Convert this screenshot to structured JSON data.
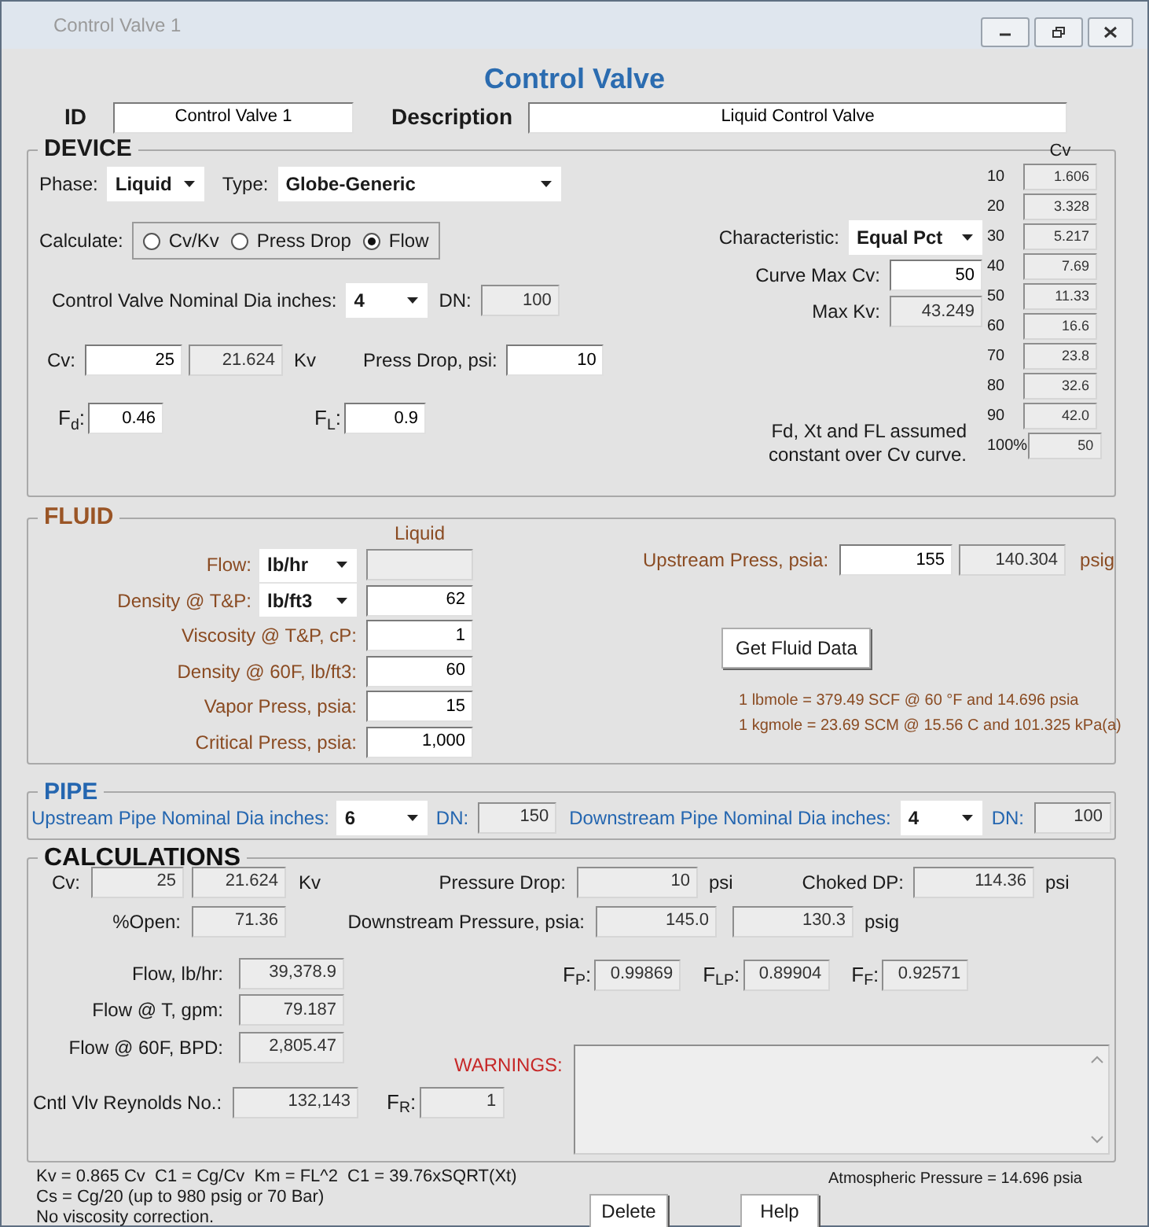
{
  "window": {
    "title": "Control Valve 1"
  },
  "heading": "Control Valve",
  "id": {
    "label": "ID",
    "field": {
      "value": "Control Valve 1",
      "readonly": false
    }
  },
  "description": {
    "label": "Description",
    "field": {
      "value": "Liquid Control Valve",
      "readonly": false
    }
  },
  "device": {
    "title": "DEVICE",
    "phase": {
      "label": "Phase:",
      "value": "Liquid"
    },
    "type": {
      "label": "Type:",
      "value": "Globe-Generic"
    },
    "calculate": {
      "label": "Calculate:",
      "options": [
        {
          "label": "Cv/Kv",
          "selected": false
        },
        {
          "label": "Press Drop",
          "selected": false
        },
        {
          "label": "Flow",
          "selected": true
        }
      ]
    },
    "nominal_dia": {
      "label": "Control Valve Nominal Dia inches:",
      "value": "4",
      "dn_label": "DN:",
      "dn_field": {
        "value": "100",
        "readonly": true
      }
    },
    "cv": {
      "label": "Cv:",
      "field": {
        "value": "25",
        "readonly": false
      },
      "kv_field": {
        "value": "21.624",
        "readonly": true
      },
      "unit": "Kv"
    },
    "press_drop": {
      "label": "Press Drop, psi:",
      "field": {
        "value": "10",
        "readonly": false
      }
    },
    "fd": {
      "label": "F$_{d}$:",
      "field": {
        "value": "0.46",
        "readonly": false
      }
    },
    "fl": {
      "label": "F$_{L}$:",
      "field": {
        "value": "0.9",
        "readonly": false
      }
    },
    "characteristic": {
      "label": "Characteristic:",
      "value": "Equal Pct"
    },
    "curve_max_cv": {
      "label": "Curve Max Cv:",
      "field": {
        "value": "50",
        "readonly": false
      }
    },
    "max_kv": {
      "label": "Max Kv:",
      "field": {
        "value": "43.249",
        "readonly": true
      }
    },
    "note": "Fd, Xt and FL assumed constant over Cv curve.",
    "cv_curve": {
      "header": "Cv",
      "rows": [
        {
          "percent": "10",
          "field": {
            "value": "1.606",
            "readonly": true
          }
        },
        {
          "percent": "20",
          "field": {
            "value": "3.328",
            "readonly": true
          }
        },
        {
          "percent": "30",
          "field": {
            "value": "5.217",
            "readonly": true
          }
        },
        {
          "percent": "40",
          "field": {
            "value": "7.69",
            "readonly": true
          }
        },
        {
          "percent": "50",
          "field": {
            "value": "11.33",
            "readonly": true
          }
        },
        {
          "percent": "60",
          "field": {
            "value": "16.6",
            "readonly": true
          }
        },
        {
          "percent": "70",
          "field": {
            "value": "23.8",
            "readonly": true
          }
        },
        {
          "percent": "80",
          "field": {
            "value": "32.6",
            "readonly": true
          }
        },
        {
          "percent": "90",
          "field": {
            "value": "42.0",
            "readonly": true
          }
        },
        {
          "percent": "100%",
          "field": {
            "value": "50",
            "readonly": true
          }
        }
      ]
    }
  },
  "fluid": {
    "title": "FLUID",
    "column_header": "Liquid",
    "rows": [
      {
        "label": "Flow:",
        "unit": "lb/hr",
        "field": {
          "readonly": true
        }
      },
      {
        "label": "Density @ T&P:",
        "unit": "lb/ft3",
        "field": {
          "value": "62",
          "readonly": false
        }
      },
      {
        "label": "Viscosity @ T&P, cP:",
        "field": {
          "value": "1",
          "readonly": false
        }
      },
      {
        "label": "Density @ 60F, lb/ft3:",
        "field": {
          "value": "60",
          "readonly": false
        }
      },
      {
        "label": "Vapor Press, psia:",
        "field": {
          "value": "15",
          "readonly": false
        }
      },
      {
        "label": "Critical Press, psia:",
        "field": {
          "value": "1,000",
          "readonly": false
        }
      }
    ],
    "upstream_press": {
      "label": "Upstream Press, psia:",
      "field": {
        "value": "155",
        "readonly": false
      },
      "psig_field": {
        "value": "140.304",
        "readonly": true
      },
      "unit": "psig"
    },
    "button": "Get Fluid Data",
    "notes": [
      "1 lbmole = 379.49 SCF @ 60 °F and 14.696 psia",
      "1 kgmole = 23.69 SCM @ 15.56 C and 101.325 kPa(a)"
    ]
  },
  "pipe": {
    "title": "PIPE",
    "upstream": {
      "label": "Upstream Pipe Nominal Dia inches:",
      "value": "6",
      "dn_label": "DN:",
      "dn_field": {
        "value": "150",
        "readonly": true
      }
    },
    "downstream": {
      "label": "Downstream Pipe Nominal Dia inches:",
      "value": "4",
      "dn_label": "DN:",
      "dn_field": {
        "value": "100",
        "readonly": true
      }
    }
  },
  "calculations": {
    "title": "CALCULATIONS",
    "cv": {
      "label": "Cv:",
      "field": {
        "value": "25",
        "readonly": true
      },
      "kv_field": {
        "value": "21.624",
        "readonly": true
      },
      "unit": "Kv"
    },
    "pressure_drop": {
      "label": "Pressure Drop:",
      "field": {
        "value": "10",
        "readonly": true
      },
      "unit": "psi"
    },
    "choked_dp": {
      "label": "Choked DP:",
      "field": {
        "value": "114.36",
        "readonly": true
      },
      "unit": "psi"
    },
    "open": {
      "label": "%Open:",
      "field": {
        "value": "71.36",
        "readonly": true
      }
    },
    "downstream_pressure": {
      "label": "Downstream Pressure, psia:",
      "field": {
        "value": "145.0",
        "readonly": true
      },
      "psig_field": {
        "value": "130.3",
        "readonly": true
      },
      "unit": "psig"
    },
    "flows": [
      {
        "label": "Flow, lb/hr:",
        "field": {
          "value": "39,378.9",
          "readonly": true
        }
      },
      {
        "label": "Flow @ T, gpm:",
        "field": {
          "value": "79.187",
          "readonly": true
        }
      },
      {
        "label": "Flow @ 60F, BPD:",
        "field": {
          "value": "2,805.47",
          "readonly": true
        }
      }
    ],
    "factors": [
      {
        "label": "F$_{P}$:",
        "field": {
          "value": "0.99869",
          "readonly": true
        }
      },
      {
        "label": "F$_{LP}$:",
        "field": {
          "value": "0.89904",
          "readonly": true
        }
      },
      {
        "label": "F$_{F}$:",
        "field": {
          "value": "0.92571",
          "readonly": true
        }
      }
    ],
    "reynolds": {
      "label": "Cntl Vlv Reynolds No.:",
      "field": {
        "value": "132,143",
        "readonly": true
      }
    },
    "fr": {
      "label": "F$_{R}$:",
      "field": {
        "value": "1",
        "readonly": true
      }
    },
    "warnings_label": "WARNINGS:"
  },
  "footer": {
    "notes": [
      "Kv = 0.865 Cv  C1 = Cg/Cv  Km = FL^2  C1 = 39.76xSQRT(Xt)",
      "Cs = Cg/20 (up to 980 psig or 70 Bar)",
      "No viscosity correction."
    ],
    "atmospheric": "Atmospheric Pressure = 14.696 psia",
    "buttons": [
      "Delete",
      "Help"
    ]
  }
}
